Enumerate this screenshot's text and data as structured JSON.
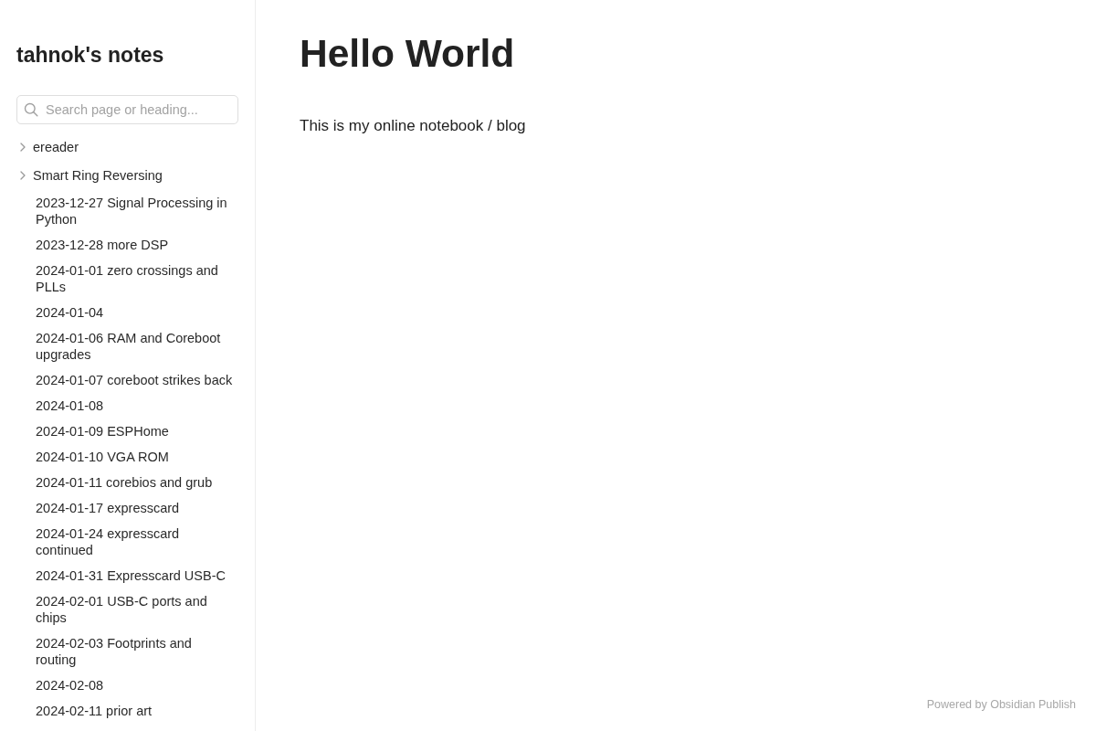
{
  "sidebar": {
    "site_title": "tahnok's notes",
    "search": {
      "placeholder": "Search page or heading..."
    },
    "tree": [
      {
        "kind": "folder",
        "label": "ereader",
        "expanded": false
      },
      {
        "kind": "folder",
        "label": "Smart Ring Reversing",
        "expanded": false
      },
      {
        "kind": "file",
        "label": "2023-12-27 Signal Processing in Python"
      },
      {
        "kind": "file",
        "label": "2023-12-28 more DSP"
      },
      {
        "kind": "file",
        "label": "2024-01-01 zero crossings and PLLs"
      },
      {
        "kind": "file",
        "label": "2024-01-04"
      },
      {
        "kind": "file",
        "label": "2024-01-06 RAM and Coreboot upgrades"
      },
      {
        "kind": "file",
        "label": "2024-01-07 coreboot strikes back"
      },
      {
        "kind": "file",
        "label": "2024-01-08"
      },
      {
        "kind": "file",
        "label": "2024-01-09 ESPHome"
      },
      {
        "kind": "file",
        "label": "2024-01-10 VGA ROM"
      },
      {
        "kind": "file",
        "label": "2024-01-11 corebios and grub"
      },
      {
        "kind": "file",
        "label": "2024-01-17 expresscard"
      },
      {
        "kind": "file",
        "label": "2024-01-24 expresscard continued"
      },
      {
        "kind": "file",
        "label": "2024-01-31 Expresscard USB-C"
      },
      {
        "kind": "file",
        "label": "2024-02-01 USB-C ports and chips"
      },
      {
        "kind": "file",
        "label": "2024-02-03 Footprints and routing"
      },
      {
        "kind": "file",
        "label": "2024-02-08"
      },
      {
        "kind": "file",
        "label": "2024-02-11 prior art"
      }
    ]
  },
  "main": {
    "title": "Hello World",
    "body": "This is my online notebook / blog"
  },
  "footer": {
    "text": "Powered by Obsidian Publish"
  }
}
